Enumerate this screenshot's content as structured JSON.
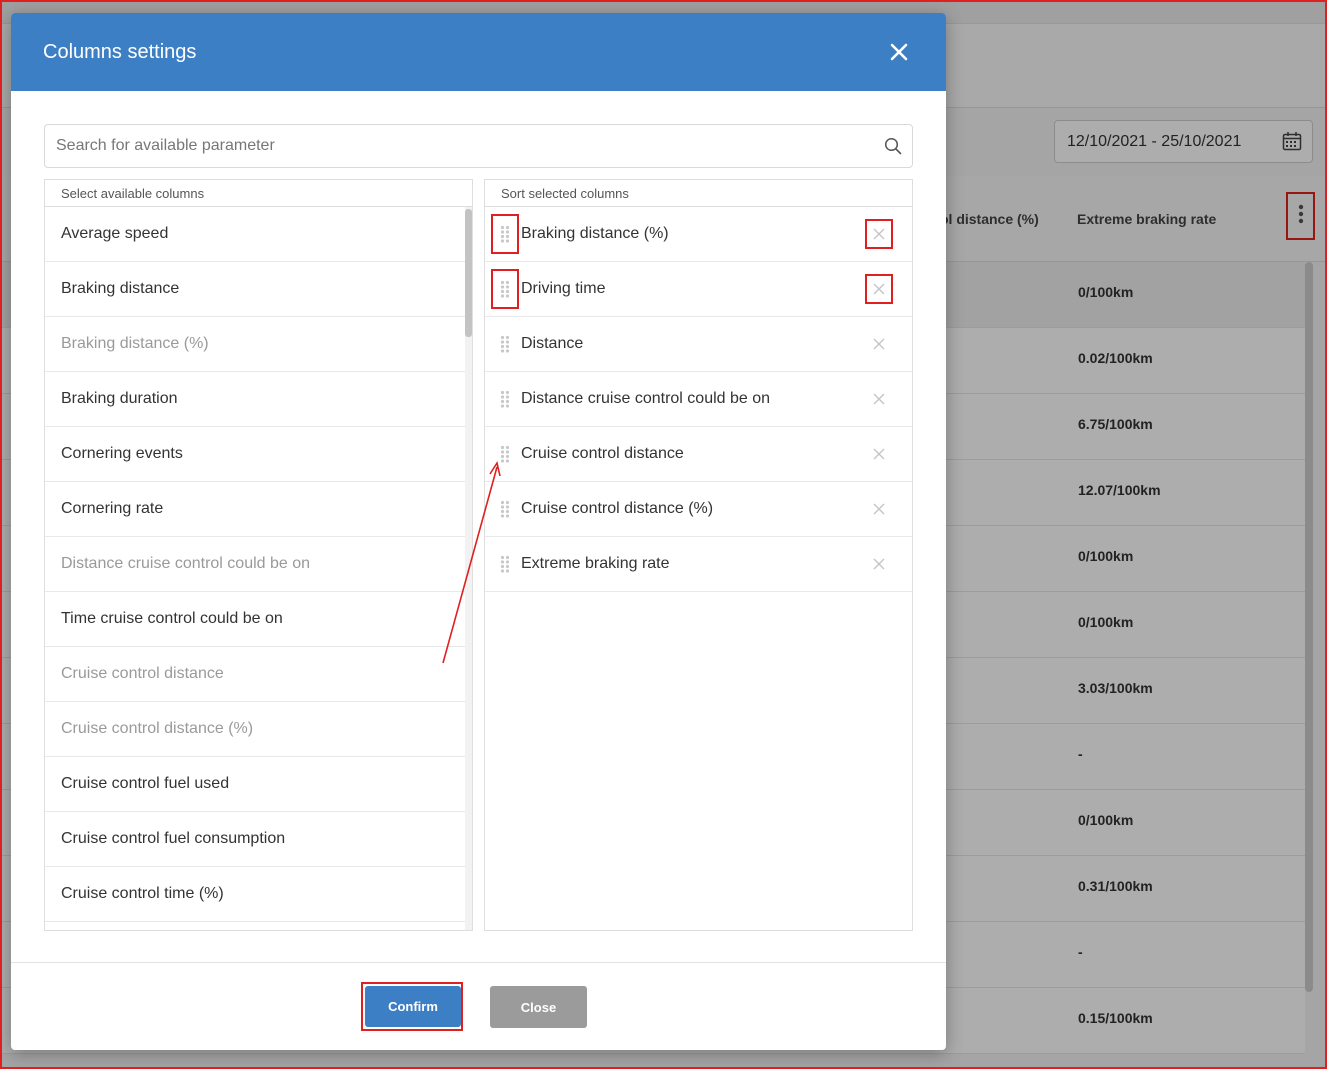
{
  "background": {
    "date_range": "12/10/2021 - 25/10/2021",
    "columns": [
      "ol distance (%)",
      "Extreme braking rate"
    ],
    "rows": [
      "0/100km",
      "0.02/100km",
      "6.75/100km",
      "12.07/100km",
      "0/100km",
      "0/100km",
      "3.03/100km",
      "-",
      "0/100km",
      "0.31/100km",
      "-",
      "0.15/100km"
    ]
  },
  "modal": {
    "title": "Columns settings",
    "search_placeholder": "Search for available parameter",
    "available_header": "Select available columns",
    "selected_header": "Sort selected columns",
    "available": [
      {
        "label": "Average speed",
        "selected": false
      },
      {
        "label": "Braking distance",
        "selected": false
      },
      {
        "label": "Braking distance (%)",
        "selected": true
      },
      {
        "label": "Braking duration",
        "selected": false
      },
      {
        "label": "Cornering events",
        "selected": false
      },
      {
        "label": "Cornering rate",
        "selected": false
      },
      {
        "label": "Distance cruise control could be on",
        "selected": true
      },
      {
        "label": "Time cruise control could be on",
        "selected": false
      },
      {
        "label": "Cruise control distance",
        "selected": true
      },
      {
        "label": "Cruise control distance (%)",
        "selected": true
      },
      {
        "label": "Cruise control fuel used",
        "selected": false
      },
      {
        "label": "Cruise control fuel consumption",
        "selected": false
      },
      {
        "label": "Cruise control time (%)",
        "selected": false
      },
      {
        "label": "",
        "selected": false
      }
    ],
    "selected": [
      "Braking distance (%)",
      "Driving time",
      "Distance",
      "Distance cruise control could be on",
      "Cruise control distance",
      "Cruise control distance (%)",
      "Extreme braking rate"
    ],
    "confirm_label": "Confirm",
    "close_label": "Close"
  },
  "colors": {
    "accent": "#3d7fc4",
    "annotation": "#e02020",
    "close_button": "#9b9b9b"
  }
}
